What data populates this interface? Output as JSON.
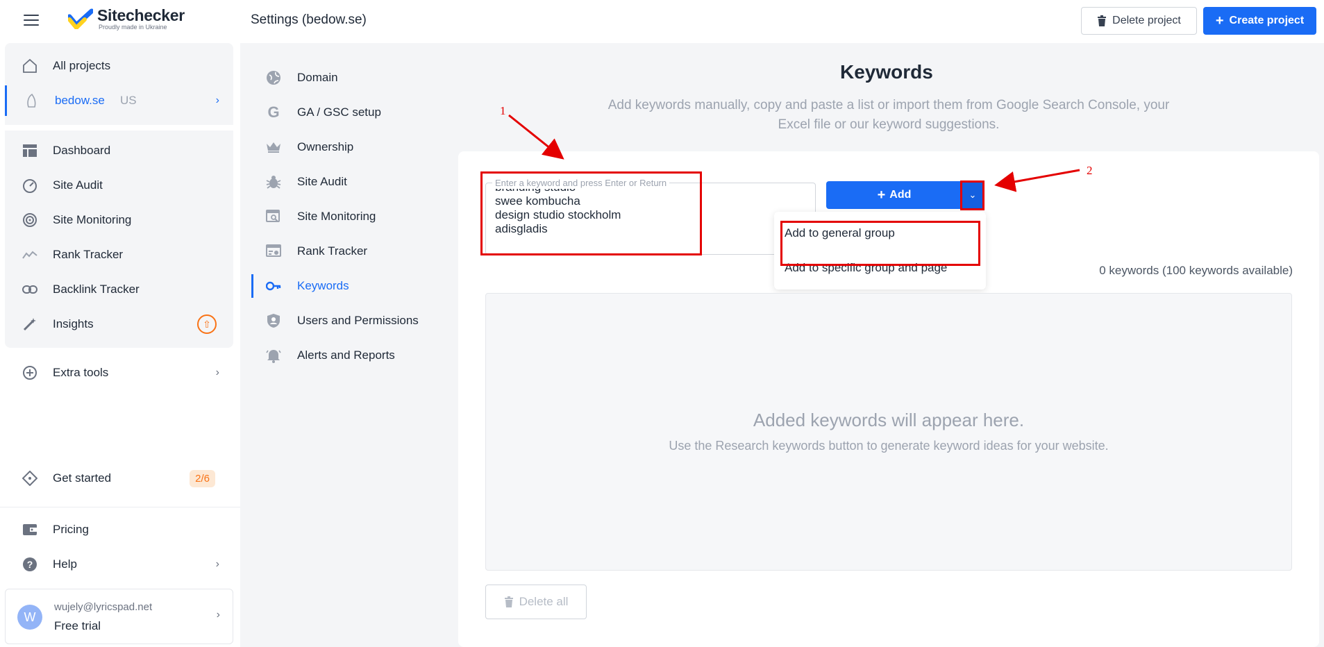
{
  "header": {
    "brand": "Sitechecker",
    "brand_tagline": "Proudly made in Ukraine",
    "page_title": "Settings (bedow.se)",
    "delete_project_label": "Delete project",
    "create_project_label": "Create project"
  },
  "sidebar": {
    "all_projects": "All projects",
    "project_name": "bedow.se",
    "project_region": "US",
    "items": [
      {
        "label": "Dashboard",
        "icon": "dashboard-icon"
      },
      {
        "label": "Site Audit",
        "icon": "gauge-icon"
      },
      {
        "label": "Site Monitoring",
        "icon": "monitoring-icon"
      },
      {
        "label": "Rank Tracker",
        "icon": "trend-icon"
      },
      {
        "label": "Backlink Tracker",
        "icon": "link-icon"
      },
      {
        "label": "Insights",
        "icon": "magic-wand-icon"
      }
    ],
    "extra_tools": "Extra tools",
    "get_started": "Get started",
    "get_started_progress": "2/6",
    "pricing": "Pricing",
    "help": "Help",
    "user": {
      "initial": "W",
      "email": "wujely@lyricspad.net",
      "plan": "Free trial"
    }
  },
  "settings_nav": {
    "items": [
      {
        "label": "Domain",
        "icon": "globe-icon"
      },
      {
        "label": "GA / GSC setup",
        "icon": "google-icon"
      },
      {
        "label": "Ownership",
        "icon": "crown-icon"
      },
      {
        "label": "Site Audit",
        "icon": "bug-icon"
      },
      {
        "label": "Site Monitoring",
        "icon": "monitor-search-icon"
      },
      {
        "label": "Rank Tracker",
        "icon": "rank-window-icon"
      },
      {
        "label": "Keywords",
        "icon": "key-icon"
      },
      {
        "label": "Users and Permissions",
        "icon": "shield-user-icon"
      },
      {
        "label": "Alerts and Reports",
        "icon": "bell-icon"
      }
    ],
    "active": "Keywords"
  },
  "main": {
    "title": "Keywords",
    "subtitle": "Add keywords manually, copy and paste a list or import them from Google Search Console, your Excel file or our keyword suggestions.",
    "keyword_input": {
      "label": "Enter a keyword and press Enter or Return",
      "lines": [
        "branding studio",
        "swee kombucha",
        "design studio stockholm",
        "adisgladis"
      ]
    },
    "add_label": "Add",
    "dropdown": {
      "items": [
        "Add to general group",
        "Add to specific group and page"
      ]
    },
    "keyword_count": "0 keywords (100 keywords available)",
    "empty_title": "Added keywords will appear here.",
    "empty_subtitle": "Use the Research keywords button to generate keyword ideas for your website.",
    "delete_all_label": "Delete all"
  },
  "annotations": {
    "marker_1": "1",
    "marker_2": "2",
    "color": "#e40000"
  },
  "colors": {
    "accent": "#1a6cf5",
    "badge_orange": "#f97316"
  }
}
